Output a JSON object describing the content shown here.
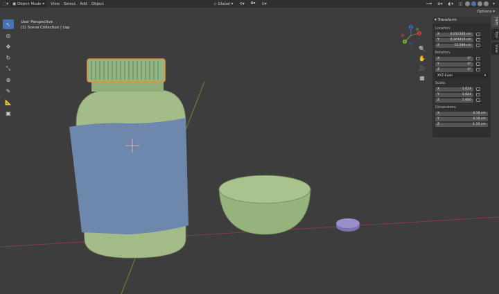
{
  "header": {
    "editor_type_icon": "3d-viewport-icon",
    "mode": "Object Mode",
    "menus": [
      "View",
      "Select",
      "Add",
      "Object"
    ],
    "transform_orientation": "Global",
    "options_label": "Options"
  },
  "viewport": {
    "perspective": "User Perspective",
    "collection_info": "(1) Scene Collection | cap"
  },
  "tools": [
    "select-box-icon",
    "cursor-icon",
    "move-icon",
    "rotate-icon",
    "scale-icon",
    "transform-icon",
    "annotate-icon",
    "measure-icon",
    "add-cube-icon"
  ],
  "gizmo": {
    "x": "X",
    "y": "Y",
    "z": "Z"
  },
  "n_panel": {
    "title": "Transform",
    "location_label": "Location:",
    "location": [
      {
        "axis": "X",
        "value": "0.012335 cm"
      },
      {
        "axis": "Y",
        "value": "0.301215 cm"
      },
      {
        "axis": "Z",
        "value": "15.596 cm"
      }
    ],
    "rotation_label": "Rotation:",
    "rotation": [
      {
        "axis": "X",
        "value": "0°"
      },
      {
        "axis": "Y",
        "value": "0°"
      },
      {
        "axis": "Z",
        "value": "0°"
      }
    ],
    "rotation_mode": "XYZ Euler",
    "scale_label": "Scale:",
    "scale": [
      {
        "axis": "X",
        "value": "1.024"
      },
      {
        "axis": "Y",
        "value": "1.024"
      },
      {
        "axis": "Z",
        "value": "1.000"
      }
    ],
    "dimensions_label": "Dimensions:",
    "dimensions": [
      {
        "axis": "X",
        "value": "4.16 cm"
      },
      {
        "axis": "Y",
        "value": "4.16 cm"
      },
      {
        "axis": "Z",
        "value": "1.15 cm"
      }
    ]
  },
  "side_tabs": [
    "Item",
    "Tool",
    "View"
  ],
  "colors": {
    "accent": "#4772b3",
    "background": "#3d3d3d",
    "selection_outline": "#e8902c",
    "bottle_green": "#a4bc87",
    "label_blue": "#6d88ac",
    "bowl_green": "#95b37a",
    "pill_purple": "#9a8ecb",
    "x_axis": "#9a3c46",
    "y_axis": "#6e8a33"
  }
}
